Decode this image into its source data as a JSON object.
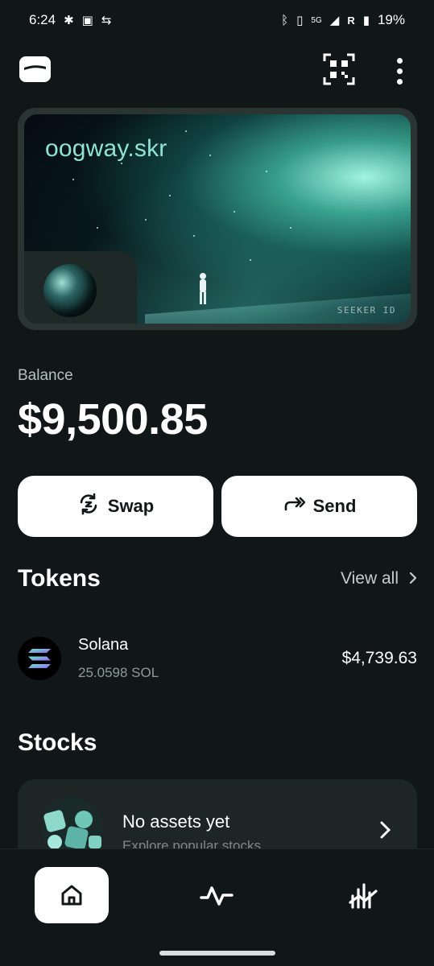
{
  "status_bar": {
    "time": "6:24",
    "network": "5G",
    "roaming": "R",
    "battery": "19%"
  },
  "header": {
    "logo_icon": "wallet-logo-icon",
    "qr_icon": "qr-code-icon",
    "menu_icon": "more-vertical-icon"
  },
  "card": {
    "name": "oogway.skr",
    "label": "SEEKER ID"
  },
  "balance": {
    "label": "Balance",
    "value": "$9,500.85"
  },
  "actions": {
    "swap_label": "Swap",
    "send_label": "Send"
  },
  "tokens": {
    "title": "Tokens",
    "view_all": "View all",
    "items": [
      {
        "name": "Solana",
        "amount": "25.0598 SOL",
        "value": "$4,739.63",
        "icon": "solana-icon"
      }
    ]
  },
  "stocks": {
    "title": "Stocks",
    "empty_title": "No assets yet",
    "empty_subtitle": "Explore popular stocks"
  },
  "nav": {
    "items": [
      "home-icon",
      "activity-icon",
      "chart-icon"
    ]
  },
  "colors": {
    "background": "#111716",
    "accent": "#8fe3d2",
    "button": "#ffffff"
  }
}
